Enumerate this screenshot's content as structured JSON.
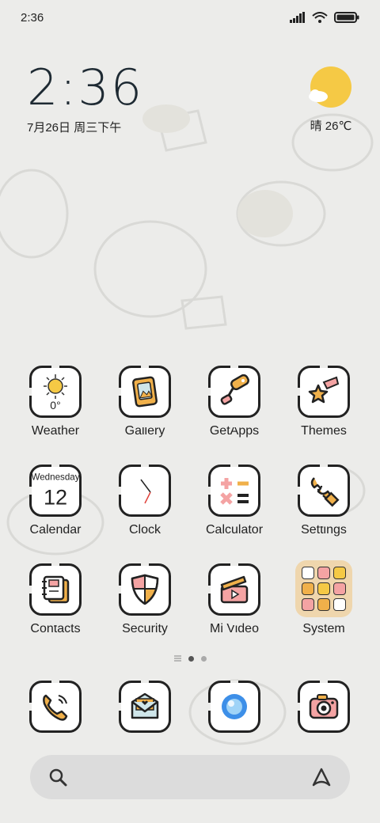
{
  "status_bar": {
    "time": "2:36",
    "icons": [
      "signal-icon",
      "wifi-icon",
      "battery-icon"
    ]
  },
  "clock_widget": {
    "time": "2:36",
    "date": "7月26日 周三下午"
  },
  "weather_widget": {
    "text": "晴 26℃",
    "icon": "partly-sunny-icon"
  },
  "apps": [
    {
      "label": "Weather",
      "icon": "weather-sun-icon",
      "badge": "0°"
    },
    {
      "label": "Gallery",
      "icon": "gallery-icon"
    },
    {
      "label": "GetApps",
      "icon": "paint-roller-icon"
    },
    {
      "label": "Themes",
      "icon": "shooting-star-icon"
    },
    {
      "label": "Calendar",
      "icon": "calendar-icon",
      "weekday": "Wednesday",
      "day": "12"
    },
    {
      "label": "Clock",
      "icon": "clock-icon"
    },
    {
      "label": "Calculator",
      "icon": "calculator-icon"
    },
    {
      "label": "Settings",
      "icon": "wrench-icon"
    },
    {
      "label": "Contacts",
      "icon": "contacts-notebook-icon"
    },
    {
      "label": "Security",
      "icon": "shield-icon"
    },
    {
      "label": "Mi Video",
      "icon": "video-clapper-icon"
    },
    {
      "label": "System",
      "icon": "folder-icon"
    }
  ],
  "dock": [
    {
      "name": "phone",
      "icon": "phone-icon"
    },
    {
      "name": "messages",
      "icon": "envelope-icon"
    },
    {
      "name": "browser",
      "icon": "browser-bubble-icon"
    },
    {
      "name": "camera",
      "icon": "camera-icon"
    }
  ],
  "search_bar": {
    "left_icon": "search-icon",
    "right_icon": "assistant-icon"
  },
  "colors": {
    "background": "#ececea",
    "accent_yellow": "#f5c945",
    "accent_orange": "#f0b04a",
    "accent_pink": "#f4a3a3",
    "folder": "#efd6ad"
  }
}
